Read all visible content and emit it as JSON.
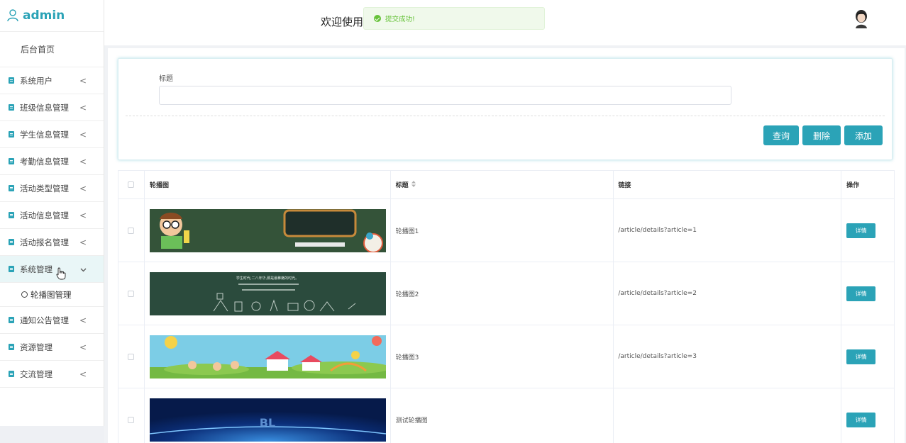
{
  "brand": {
    "name": "admin"
  },
  "sidebar": {
    "home": "后台首页",
    "items": [
      {
        "label": "系统用户",
        "chevron": "<"
      },
      {
        "label": "班级信息管理",
        "chevron": "<"
      },
      {
        "label": "学生信息管理",
        "chevron": "<"
      },
      {
        "label": "考勤信息管理",
        "chevron": "<"
      },
      {
        "label": "活动类型管理",
        "chevron": "<"
      },
      {
        "label": "活动信息管理",
        "chevron": "<"
      },
      {
        "label": "活动报名管理",
        "chevron": "<"
      },
      {
        "label": "系统管理",
        "chevron": "v"
      },
      {
        "label": "通知公告管理",
        "chevron": "<"
      },
      {
        "label": "资源管理",
        "chevron": "<"
      },
      {
        "label": "交流管理",
        "chevron": "<"
      }
    ],
    "submenu": {
      "label": "轮播图管理"
    }
  },
  "header": {
    "welcome": "欢迎使用",
    "toast": "提交成功!"
  },
  "search": {
    "label": "标题",
    "value": "",
    "buttons": {
      "query": "查询",
      "delete": "删除",
      "add": "添加"
    }
  },
  "table": {
    "headers": {
      "image": "轮播图",
      "title": "标题",
      "link": "链接",
      "op": "操作"
    },
    "rows": [
      {
        "title": "轮播图1",
        "link": "/article/details?article=1",
        "action": "详情",
        "banner_text": ""
      },
      {
        "title": "轮播图2",
        "link": "/article/details?article=2",
        "action": "详情",
        "banner_text": "学生时代,二八年华,那是最稚嫩的时光。"
      },
      {
        "title": "轮播图3",
        "link": "/article/details?article=3",
        "action": "详情",
        "banner_text": ""
      },
      {
        "title": "测试轮播图",
        "link": "",
        "action": "详情",
        "banner_text": "BL"
      }
    ]
  },
  "colors": {
    "accent": "#2ba3b7",
    "success": "#67c23a"
  }
}
